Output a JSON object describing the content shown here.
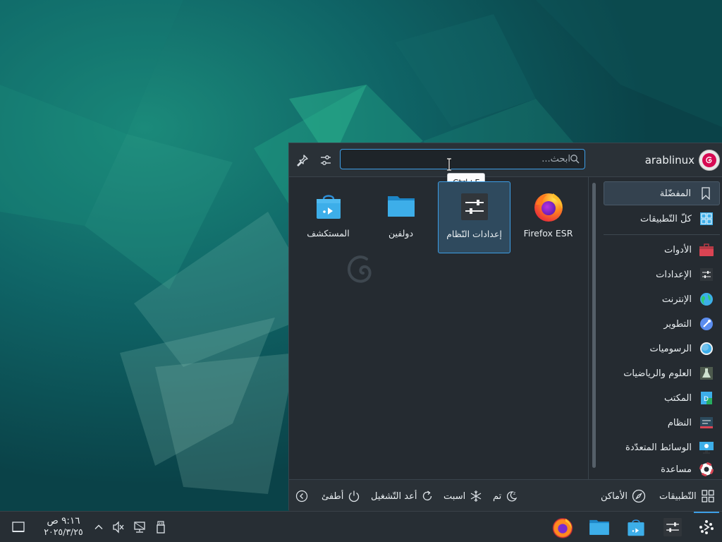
{
  "launcher": {
    "search": {
      "placeholder": "ابحث...",
      "value": ""
    },
    "tooltip": "Ctrl+F",
    "user": {
      "name": "arablinux"
    },
    "apps": [
      {
        "label": "Firefox ESR",
        "icon": "firefox-icon"
      },
      {
        "label": "إعدادات النّظام",
        "icon": "system-settings-icon",
        "selected": true
      },
      {
        "label": "دولفين",
        "icon": "dolphin-folder-icon"
      },
      {
        "label": "المستكشف",
        "icon": "discover-icon"
      }
    ],
    "categories": [
      {
        "label": "المفضّلة",
        "icon": "bookmark-icon",
        "selected": true
      },
      {
        "label": "كلّ التّطبيقات",
        "icon": "all-apps-icon"
      },
      {
        "label": "الأدوات",
        "icon": "utilities-icon"
      },
      {
        "label": "الإعدادات",
        "icon": "settings-icon"
      },
      {
        "label": "الإنترنت",
        "icon": "internet-globe-icon"
      },
      {
        "label": "التطوير",
        "icon": "development-icon"
      },
      {
        "label": "الرسوميات",
        "icon": "graphics-icon"
      },
      {
        "label": "العلوم والرياضيات",
        "icon": "science-icon"
      },
      {
        "label": "المكتب",
        "icon": "office-icon"
      },
      {
        "label": "النظام",
        "icon": "system-icon"
      },
      {
        "label": "الوسائط المتعدّدة",
        "icon": "multimedia-icon"
      },
      {
        "label": "مساعدة",
        "icon": "help-lifebuoy-icon"
      }
    ],
    "footer": {
      "applications_tab": "التّطبيقات",
      "places_tab": "الأماكن",
      "sleep": "تم",
      "hibernate": "اسبت",
      "restart": "أعد التّشغيل",
      "shutdown": "أطفئ"
    }
  },
  "taskbar": {
    "clock": {
      "time": "٩:١٦ ص",
      "date": "٢٠٢٥/٣/٢٥"
    },
    "tasks": [
      "firefox-icon",
      "dolphin-folder-icon",
      "discover-icon",
      "system-settings-icon",
      "application-launcher-icon"
    ]
  },
  "colors": {
    "accent": "#3d9ee6",
    "panel": "#252b31",
    "taskbar": "#272e34",
    "desktop": "#0b4a4c"
  }
}
